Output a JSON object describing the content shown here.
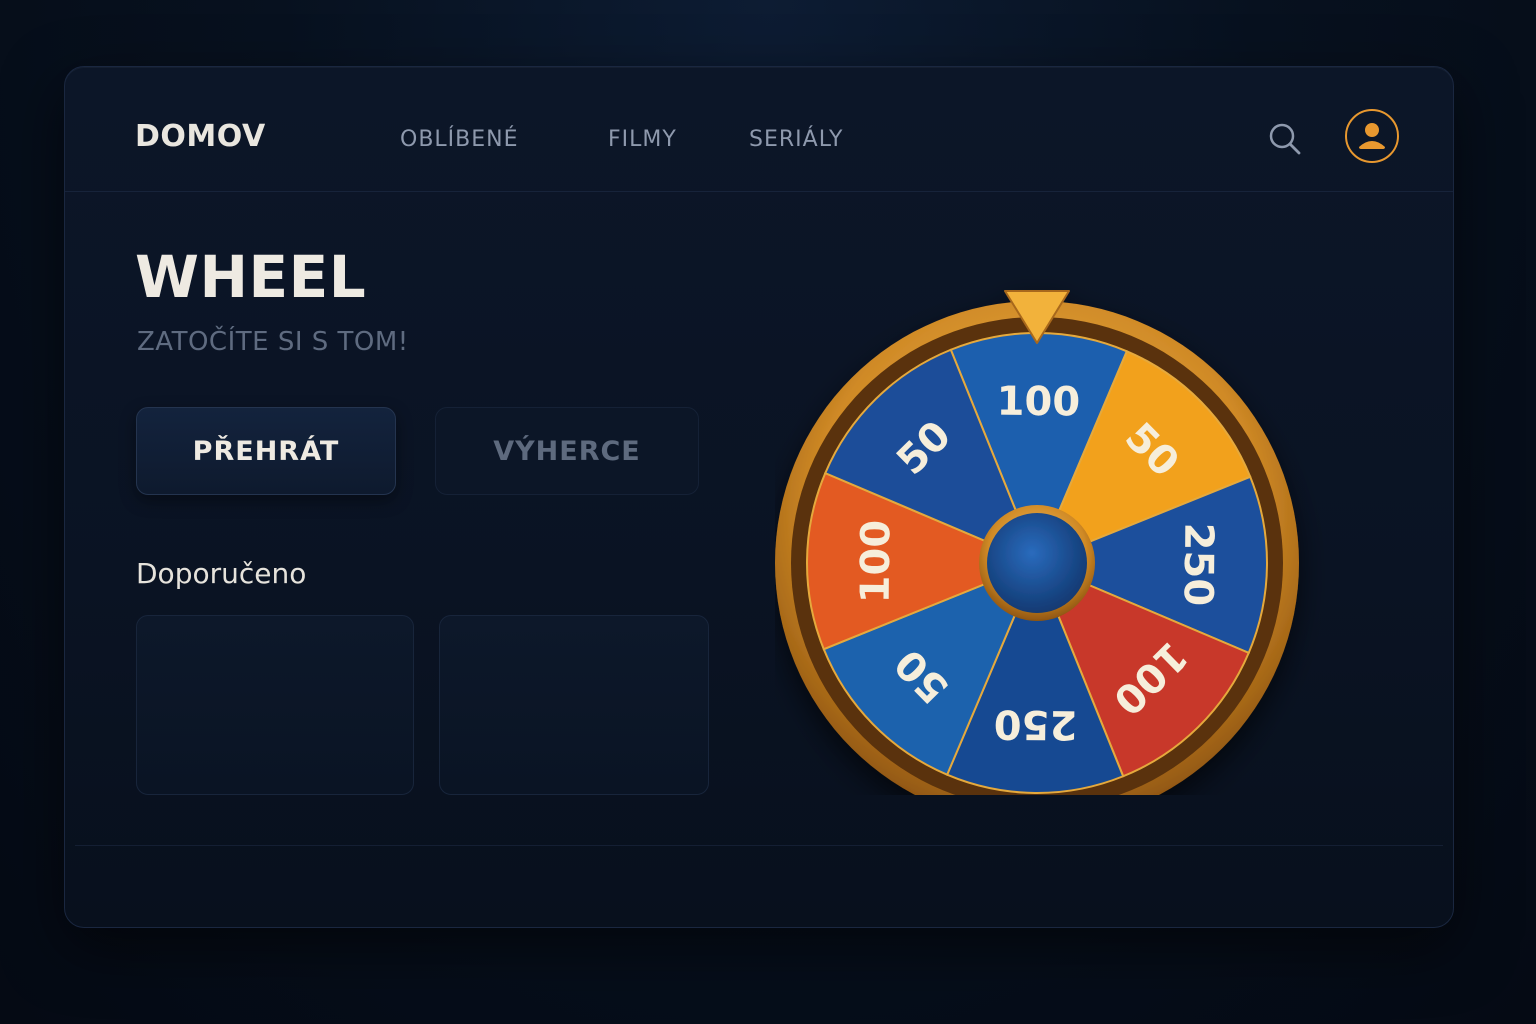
{
  "nav": {
    "brand": "DOMOV",
    "links": [
      "OBLÍBENÉ",
      "FILMY",
      "SERIÁLY"
    ],
    "search_icon": "search-icon",
    "profile_icon": "user-icon",
    "accent": "#e8982f"
  },
  "hero": {
    "title": "WHEEL",
    "subtitle": "ZATOČÍTE SI S TOM!",
    "primary_button": "PŘEHRÁT",
    "secondary_button": "VÝHERCE"
  },
  "recommended": {
    "title": "Doporučeno",
    "cards": 2
  },
  "wheel": {
    "segments": [
      {
        "label": "100",
        "color": "#1f5fae"
      },
      {
        "label": "50",
        "color": "#f2a11f"
      },
      {
        "label": "250",
        "color": "#1a4f9c"
      },
      {
        "label": "100",
        "color": "#c8372a"
      },
      {
        "label": "250",
        "color": "#174a92"
      },
      {
        "label": "50",
        "color": "#1f62ad"
      },
      {
        "label": "100",
        "color": "#e35a22"
      },
      {
        "label": "50",
        "color": "#1a4e99"
      }
    ],
    "rim_color": "#d9942c",
    "pointer_color": "#f2b23a",
    "hub_color": "#1c4f95"
  }
}
